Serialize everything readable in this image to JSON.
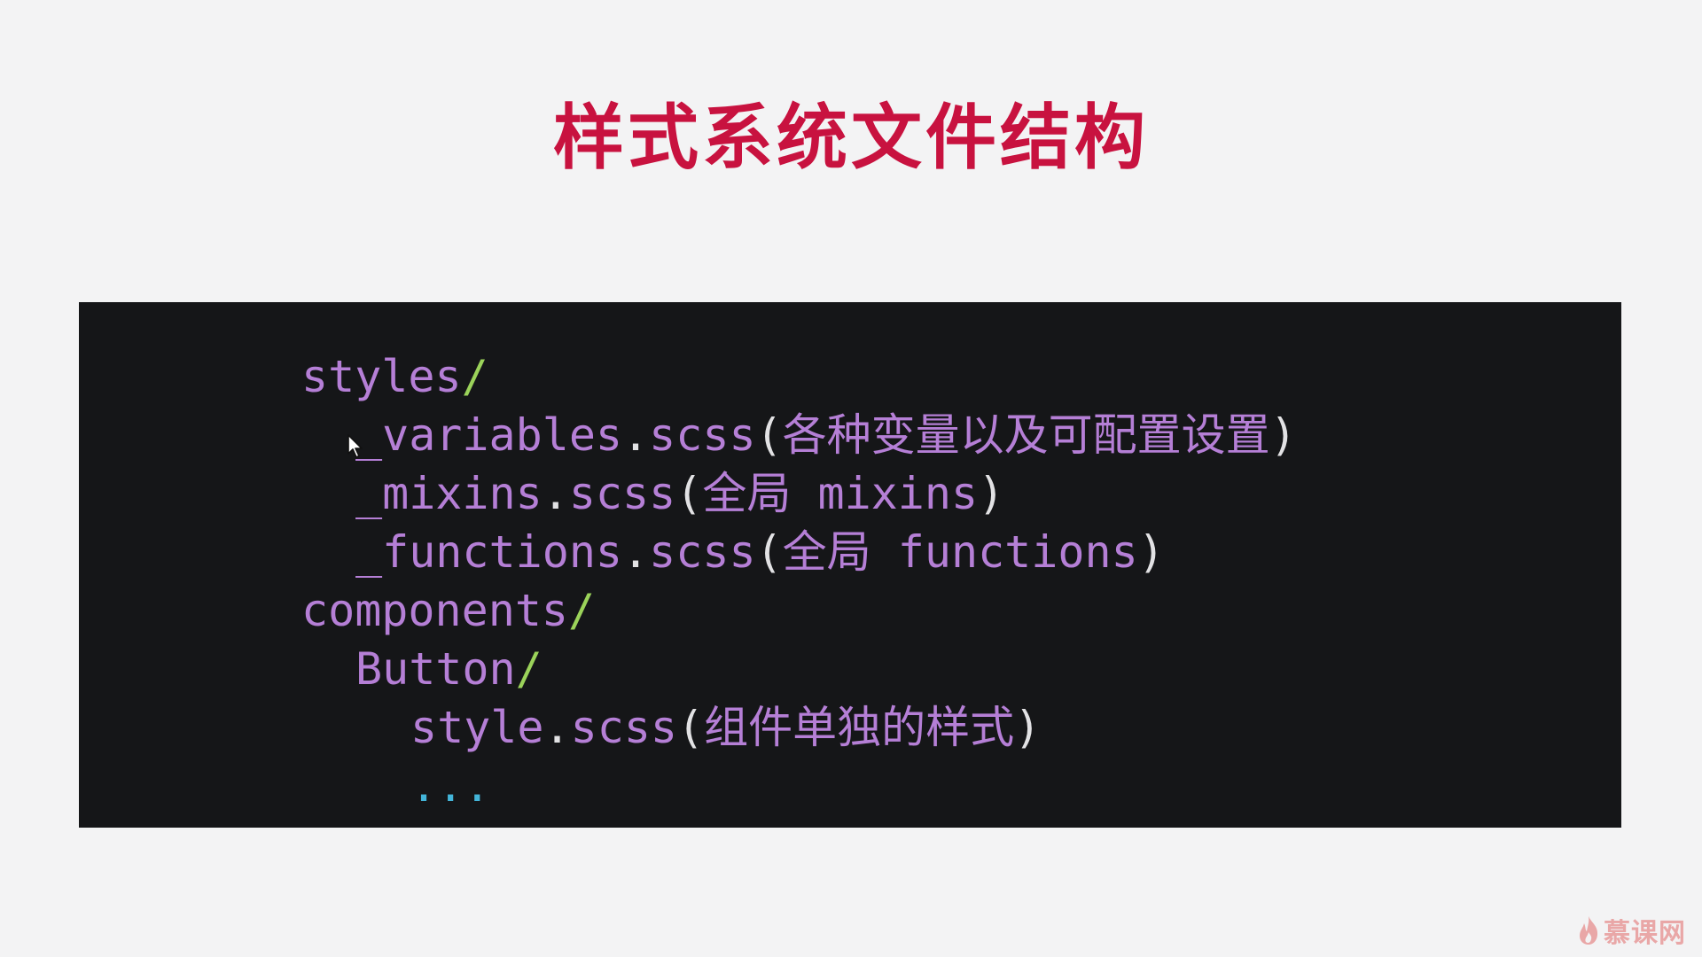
{
  "title": "样式系统文件结构",
  "colors": {
    "title": "#c8123f",
    "background": "#f3f3f4",
    "code_background": "#151618",
    "name": "#b57fd6",
    "punctuation": "#e2e2e4",
    "slash": "#9bd35a",
    "ellipsis": "#43b5d9",
    "watermark": "#e26a6a"
  },
  "code": {
    "lines": [
      {
        "name": "styles",
        "slash": "/"
      },
      {
        "file": "_variables",
        "dot": ".",
        "ext": "scss",
        "open": "(",
        "note": "各种变量以及可配置设置",
        "close": ")"
      },
      {
        "file": "_mixins",
        "dot": ".",
        "ext": "scss",
        "open": "(",
        "note": "全局 mixins",
        "close": ")"
      },
      {
        "file": "_functions",
        "dot": ".",
        "ext": "scss",
        "open": "(",
        "note": "全局 functions",
        "close": ")"
      },
      {
        "name": "components",
        "slash": "/"
      },
      {
        "name": "Button",
        "slash": "/"
      },
      {
        "file": "style",
        "dot": ".",
        "ext": "scss",
        "open": "(",
        "note": "组件单独的样式",
        "close": ")"
      },
      {
        "ellipsis": "..."
      }
    ]
  },
  "cursor_icon": "mouse-pointer-icon",
  "watermark": {
    "icon": "flame-icon",
    "text": "慕课网"
  }
}
